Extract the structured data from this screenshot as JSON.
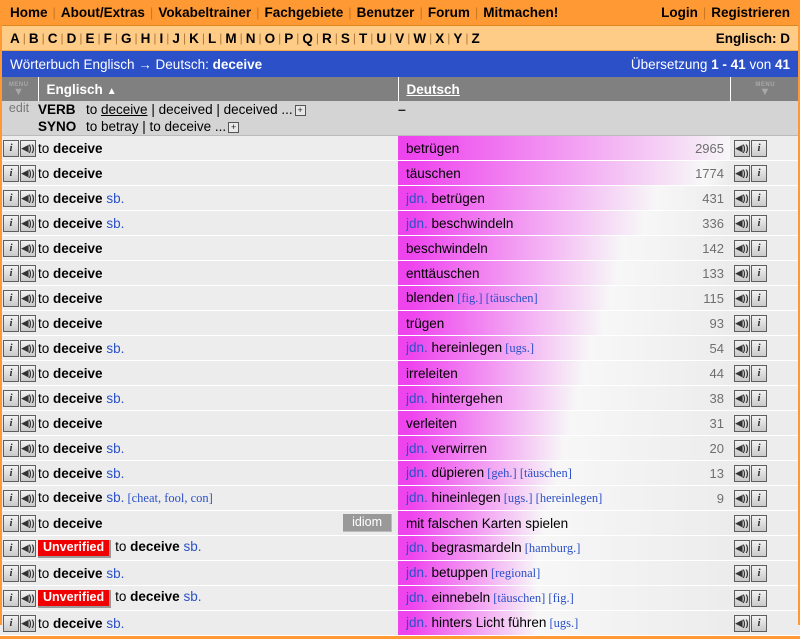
{
  "topnav": {
    "left_links": [
      "Home",
      "About/Extras",
      "Vokabeltrainer",
      "Fachgebiete",
      "Benutzer",
      "Forum",
      "Mitmachen!"
    ],
    "right_links": [
      "Login",
      "Registrieren"
    ],
    "separator": "|",
    "bg_color": "#ff9933"
  },
  "alphabar": {
    "letters": [
      "A",
      "B",
      "C",
      "D",
      "E",
      "F",
      "G",
      "H",
      "I",
      "J",
      "K",
      "L",
      "M",
      "N",
      "O",
      "P",
      "Q",
      "R",
      "S",
      "T",
      "U",
      "V",
      "W",
      "X",
      "Y",
      "Z"
    ],
    "separator": "|",
    "lang_indicator": "Englisch: D",
    "bg_color": "#ffcc88"
  },
  "titlebar": {
    "prefix": "Wörterbuch Englisch → Deutsch: ",
    "term": "deceive",
    "result_prefix": "Übersetzung ",
    "result_range": "1 - 41",
    "result_middle": " von ",
    "result_total": "41",
    "bg_color": "#2b50c8"
  },
  "table_header": {
    "menu_label": "MENU",
    "menu_arrow": "▼",
    "col_english": "Englisch",
    "sort_arrow": "▲",
    "col_german": "Deutsch"
  },
  "inforow": {
    "edit_label": "edit",
    "verb_label": "VERB",
    "verb_forms_pre": "to ",
    "verb_forms_main": "deceive",
    "verb_forms_rest": " | deceived | deceived ...",
    "syno_label": "SYNO",
    "syno_text": "to betray | to deceive ...",
    "expand_icon": "+",
    "german_dash": "–"
  },
  "icons": {
    "info": "i",
    "speaker": "◀))"
  },
  "badges": {
    "unverified": "Unverified",
    "idiom": "idiom"
  },
  "rows": [
    {
      "en_pre": "to ",
      "en_main": "deceive",
      "en_sb": "",
      "en_note": "",
      "unverified": false,
      "idiom": false,
      "de_jdn": "",
      "de_main": "betrügen",
      "de_notes": [],
      "count": "2965",
      "bar": 100
    },
    {
      "en_pre": "to ",
      "en_main": "deceive",
      "en_sb": "",
      "en_note": "",
      "unverified": false,
      "idiom": false,
      "de_jdn": "",
      "de_main": "täuschen",
      "de_notes": [],
      "count": "1774",
      "bar": 92
    },
    {
      "en_pre": "to ",
      "en_main": "deceive",
      "en_sb": " sb.",
      "en_note": "",
      "unverified": false,
      "idiom": false,
      "de_jdn": "jdn. ",
      "de_main": "betrügen",
      "de_notes": [],
      "count": "431",
      "bar": 78
    },
    {
      "en_pre": "to ",
      "en_main": "deceive",
      "en_sb": " sb.",
      "en_note": "",
      "unverified": false,
      "idiom": false,
      "de_jdn": "jdn. ",
      "de_main": "beschwindeln",
      "de_notes": [],
      "count": "336",
      "bar": 74
    },
    {
      "en_pre": "to ",
      "en_main": "deceive",
      "en_sb": "",
      "en_note": "",
      "unverified": false,
      "idiom": false,
      "de_jdn": "",
      "de_main": "beschwindeln",
      "de_notes": [],
      "count": "142",
      "bar": 68
    },
    {
      "en_pre": "to ",
      "en_main": "deceive",
      "en_sb": "",
      "en_note": "",
      "unverified": false,
      "idiom": false,
      "de_jdn": "",
      "de_main": "enttäuschen",
      "de_notes": [],
      "count": "133",
      "bar": 66
    },
    {
      "en_pre": "to ",
      "en_main": "deceive",
      "en_sb": "",
      "en_note": "",
      "unverified": false,
      "idiom": false,
      "de_jdn": "",
      "de_main": "blenden",
      "de_notes": [
        "[fig.]",
        "[täuschen]"
      ],
      "count": "115",
      "bar": 64
    },
    {
      "en_pre": "to ",
      "en_main": "deceive",
      "en_sb": "",
      "en_note": "",
      "unverified": false,
      "idiom": false,
      "de_jdn": "",
      "de_main": "trügen",
      "de_notes": [],
      "count": "93",
      "bar": 62
    },
    {
      "en_pre": "to ",
      "en_main": "deceive",
      "en_sb": " sb.",
      "en_note": "",
      "unverified": false,
      "idiom": false,
      "de_jdn": "jdn. ",
      "de_main": "hereinlegen",
      "de_notes": [
        "[ugs.]"
      ],
      "count": "54",
      "bar": 58
    },
    {
      "en_pre": "to ",
      "en_main": "deceive",
      "en_sb": "",
      "en_note": "",
      "unverified": false,
      "idiom": false,
      "de_jdn": "",
      "de_main": "irreleiten",
      "de_notes": [],
      "count": "44",
      "bar": 56
    },
    {
      "en_pre": "to ",
      "en_main": "deceive",
      "en_sb": " sb.",
      "en_note": "",
      "unverified": false,
      "idiom": false,
      "de_jdn": "jdn. ",
      "de_main": "hintergehen",
      "de_notes": [],
      "count": "38",
      "bar": 54
    },
    {
      "en_pre": "to ",
      "en_main": "deceive",
      "en_sb": "",
      "en_note": "",
      "unverified": false,
      "idiom": false,
      "de_jdn": "",
      "de_main": "verleiten",
      "de_notes": [],
      "count": "31",
      "bar": 52
    },
    {
      "en_pre": "to ",
      "en_main": "deceive",
      "en_sb": " sb.",
      "en_note": "",
      "unverified": false,
      "idiom": false,
      "de_jdn": "jdn. ",
      "de_main": "verwirren",
      "de_notes": [],
      "count": "20",
      "bar": 50
    },
    {
      "en_pre": "to ",
      "en_main": "deceive",
      "en_sb": " sb.",
      "en_note": "",
      "unverified": false,
      "idiom": false,
      "de_jdn": "jdn. ",
      "de_main": "düpieren",
      "de_notes": [
        "[geh.]",
        "[täuschen]"
      ],
      "count": "13",
      "bar": 48
    },
    {
      "en_pre": "to ",
      "en_main": "deceive",
      "en_sb": " sb.",
      "en_note": "[cheat, fool, con]",
      "unverified": false,
      "idiom": false,
      "de_jdn": "jdn. ",
      "de_main": "hineinlegen",
      "de_notes": [
        "[ugs.]",
        "[hereinlegen]"
      ],
      "count": "9",
      "bar": 46
    },
    {
      "en_pre": "to ",
      "en_main": "deceive",
      "en_sb": "",
      "en_note": "",
      "unverified": false,
      "idiom": true,
      "de_jdn": "",
      "de_main": "mit falschen Karten spielen",
      "de_notes": [],
      "count": "",
      "bar": 44
    },
    {
      "en_pre": "to ",
      "en_main": "deceive",
      "en_sb": " sb.",
      "en_note": "",
      "unverified": true,
      "idiom": false,
      "de_jdn": "jdn. ",
      "de_main": "begrasmardeln",
      "de_notes": [
        "[hamburg.]"
      ],
      "count": "",
      "bar": 42
    },
    {
      "en_pre": "to ",
      "en_main": "deceive",
      "en_sb": " sb.",
      "en_note": "",
      "unverified": false,
      "idiom": false,
      "de_jdn": "jdn. ",
      "de_main": "betuppen",
      "de_notes": [
        "[regional]"
      ],
      "count": "",
      "bar": 42
    },
    {
      "en_pre": "to ",
      "en_main": "deceive",
      "en_sb": " sb.",
      "en_note": "",
      "unverified": true,
      "idiom": false,
      "de_jdn": "jdn. ",
      "de_main": "einnebeln",
      "de_notes": [
        "[täuschen]",
        "[fig.]"
      ],
      "count": "",
      "bar": 42
    },
    {
      "en_pre": "to ",
      "en_main": "deceive",
      "en_sb": " sb.",
      "en_note": "",
      "unverified": false,
      "idiom": false,
      "de_jdn": "jdn. ",
      "de_main": "hinters Licht führen",
      "de_notes": [
        "[ugs.]"
      ],
      "count": "",
      "bar": 42
    }
  ],
  "colors": {
    "accent_orange": "#ff9933",
    "accent_blue": "#2b50c8",
    "heat_magenta": "#ee44ee",
    "unverified_red": "#f00000",
    "idiom_gray": "#999999"
  }
}
